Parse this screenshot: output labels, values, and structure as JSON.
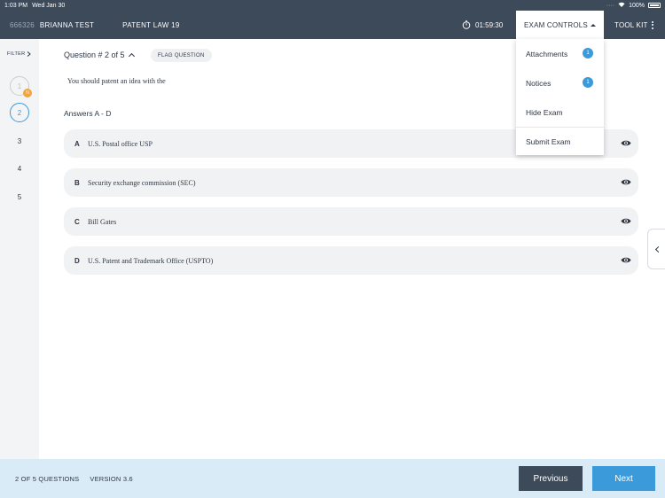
{
  "status_bar": {
    "time": "1:03 PM",
    "date": "Wed Jan 30",
    "battery": "100%"
  },
  "header": {
    "exam_id": "666326",
    "student": "BRIANNA TEST",
    "course": "PATENT LAW 19",
    "timer": "01:59:30",
    "exam_controls": "EXAM CONTROLS",
    "toolkit": "TOOL KIT"
  },
  "sidebar": {
    "filter": "FILTER",
    "questions": [
      {
        "label": "1",
        "state": "answered",
        "badge": "N"
      },
      {
        "label": "2",
        "state": "current"
      },
      {
        "label": "3",
        "state": "unanswered"
      },
      {
        "label": "4",
        "state": "unanswered"
      },
      {
        "label": "5",
        "state": "unanswered"
      }
    ]
  },
  "question": {
    "header": "Question # 2 of 5",
    "flag_label": "FLAG QUESTION",
    "text": "You should patent an idea with the",
    "answers_label": "Answers A - D",
    "answers": [
      {
        "letter": "A",
        "text": "U.S. Postal office USP"
      },
      {
        "letter": "B",
        "text": "Security exchange commission (SEC)"
      },
      {
        "letter": "C",
        "text": "Bill Gates"
      },
      {
        "letter": "D",
        "text": "U.S. Patent and Trademark Office (USPTO)"
      }
    ]
  },
  "dropdown": {
    "attachments": "Attachments",
    "attachments_count": "1",
    "notices": "Notices",
    "notices_count": "1",
    "hide_exam": "Hide Exam",
    "submit_exam": "Submit Exam"
  },
  "footer": {
    "progress": "2 OF 5 QUESTIONS",
    "version": "VERSION 3.6",
    "previous": "Previous",
    "next": "Next"
  },
  "colors": {
    "navy": "#3d4a5a",
    "accent": "#3b9ad9",
    "badge": "#f5a33a",
    "footer_bg": "#d9ebf7"
  }
}
